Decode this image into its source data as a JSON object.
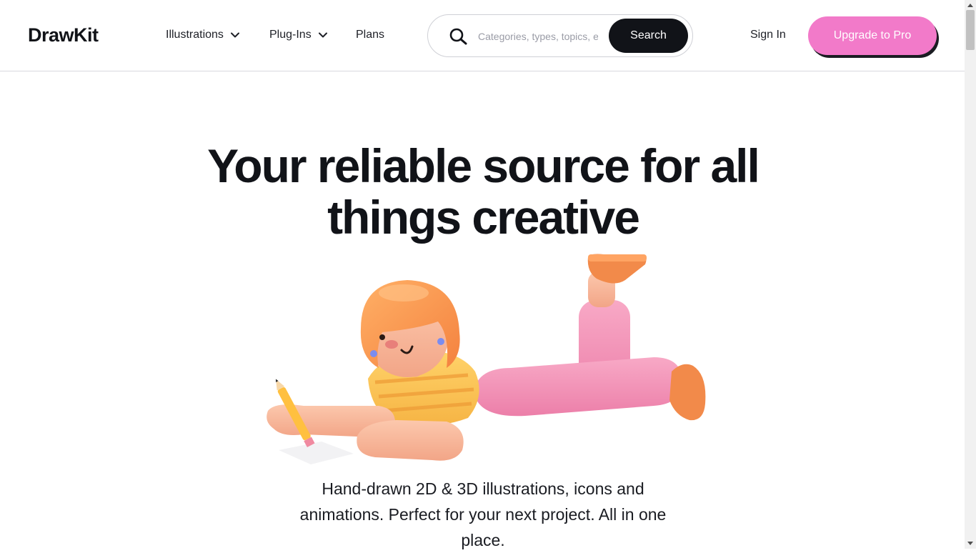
{
  "header": {
    "logo": "DrawKit",
    "nav": [
      {
        "label": "Illustrations",
        "has_dropdown": true
      },
      {
        "label": "Plug-Ins",
        "has_dropdown": true
      },
      {
        "label": "Plans",
        "has_dropdown": false
      }
    ],
    "search": {
      "placeholder": "Categories, types, topics, etc.",
      "value": "",
      "button_label": "Search",
      "icon": "search-icon"
    },
    "sign_in_label": "Sign In",
    "upgrade_label": "Upgrade to Pro"
  },
  "hero": {
    "title_line1": "Your reliable source for all",
    "title_line2": "things creative",
    "subtitle": "Hand-drawn 2D & 3D illustrations, icons and animations. Perfect for your next project. All in one place."
  },
  "colors": {
    "accent": "#f27ac9",
    "dark": "#111318",
    "border": "#d9d9de"
  }
}
